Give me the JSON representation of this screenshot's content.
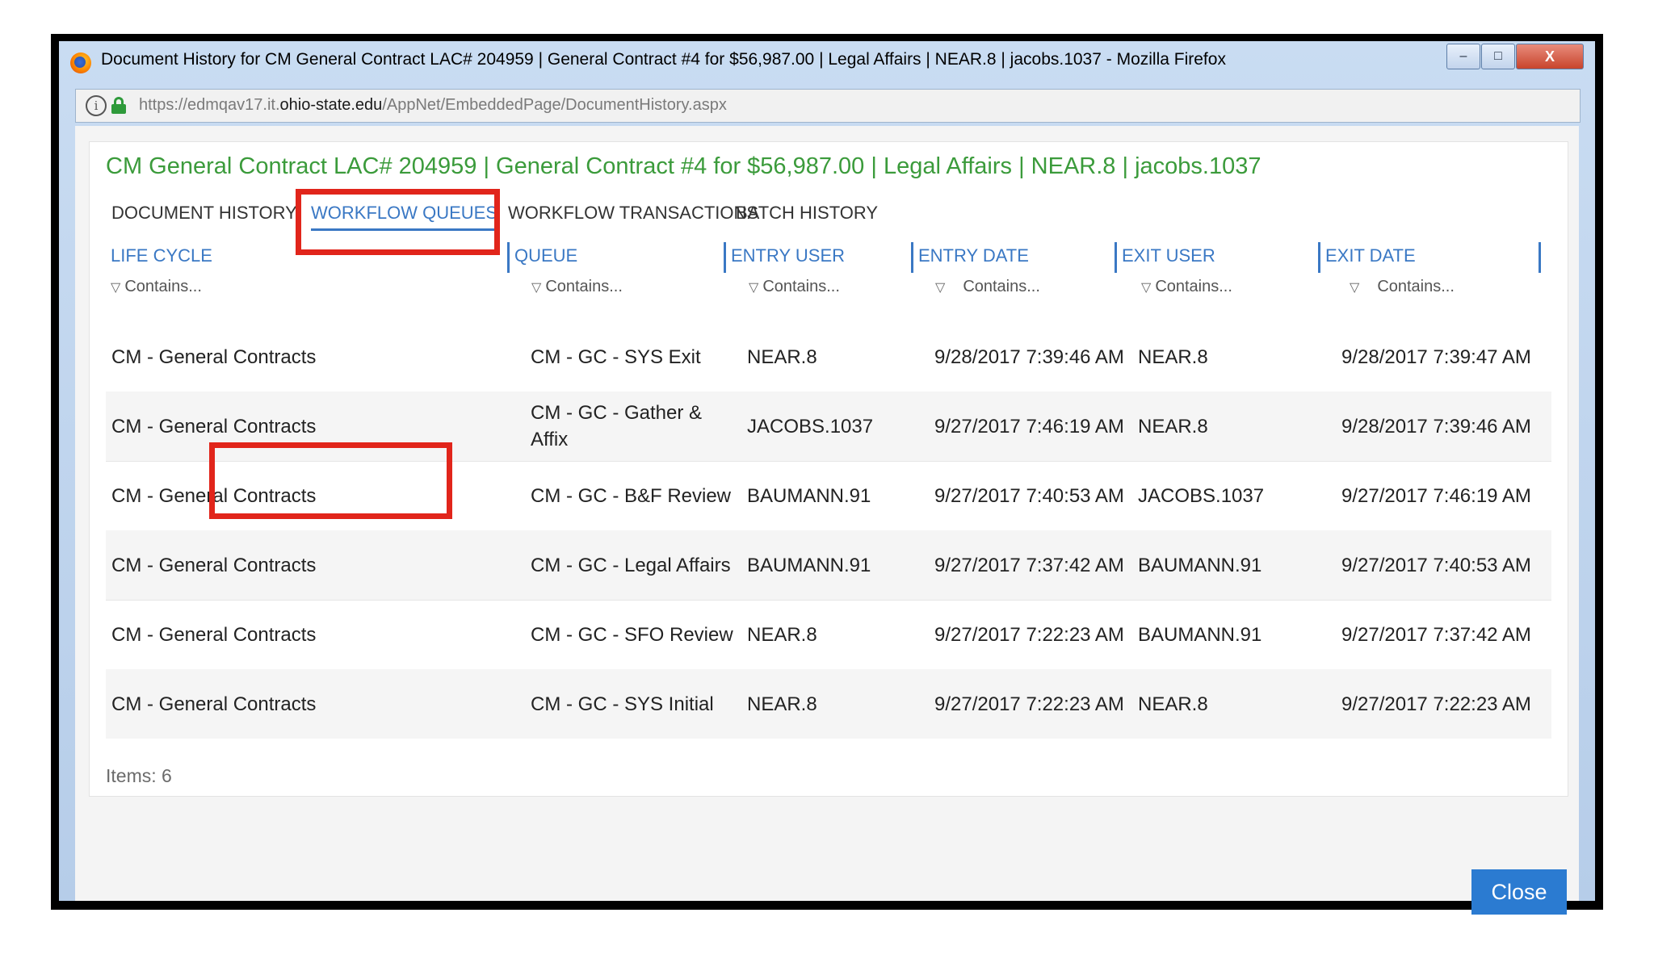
{
  "window": {
    "title": "Document History for CM General Contract LAC# 204959 | General Contract #4 for $56,987.00 | Legal Affairs | NEAR.8 | jacobs.1037 - Mozilla Firefox",
    "controls": {
      "minimize": "–",
      "maximize": "□",
      "close": "X"
    }
  },
  "urlbar": {
    "prefix": "https://edmqav17.it.",
    "domain": "ohio-state.edu",
    "path": "/AppNet/EmbeddedPage/DocumentHistory.aspx"
  },
  "document_title": "CM General Contract LAC# 204959 | General Contract #4 for $56,987.00 | Legal Affairs | NEAR.8 | jacobs.1037",
  "tabs": [
    {
      "label": "DOCUMENT HISTORY",
      "active": false
    },
    {
      "label": "WORKFLOW QUEUES",
      "active": true
    },
    {
      "label": "WORKFLOW TRANSACTIONS",
      "active": false
    },
    {
      "label": "BATCH HISTORY",
      "active": false
    }
  ],
  "grid": {
    "columns": [
      "LIFE CYCLE",
      "QUEUE",
      "ENTRY USER",
      "ENTRY DATE",
      "EXIT USER",
      "EXIT DATE"
    ],
    "filter_placeholder": "Contains...",
    "rows": [
      [
        "CM - General Contracts",
        "CM - GC - SYS Exit",
        "NEAR.8",
        "9/28/2017 7:39:46 AM",
        "NEAR.8",
        "9/28/2017 7:39:47 AM"
      ],
      [
        "CM - General Contracts",
        "CM - GC - Gather & Affix",
        "JACOBS.1037",
        "9/27/2017 7:46:19 AM",
        "NEAR.8",
        "9/28/2017 7:39:46 AM"
      ],
      [
        "CM - General Contracts",
        "CM - GC - B&F Review",
        "BAUMANN.91",
        "9/27/2017 7:40:53 AM",
        "JACOBS.1037",
        "9/27/2017 7:46:19 AM"
      ],
      [
        "CM - General Contracts",
        "CM - GC - Legal Affairs",
        "BAUMANN.91",
        "9/27/2017 7:37:42 AM",
        "BAUMANN.91",
        "9/27/2017 7:40:53 AM"
      ],
      [
        "CM - General Contracts",
        "CM - GC - SFO Review",
        "NEAR.8",
        "9/27/2017 7:22:23 AM",
        "BAUMANN.91",
        "9/27/2017 7:37:42 AM"
      ],
      [
        "CM - General Contracts",
        "CM - GC - SYS Initial",
        "NEAR.8",
        "9/27/2017 7:22:23 AM",
        "NEAR.8",
        "9/27/2017 7:22:23 AM"
      ]
    ]
  },
  "items_label": "Items: 6",
  "close_label": "Close",
  "colors": {
    "accent": "#3a78c4",
    "title_green": "#3b9b3b",
    "highlight_red": "#e1251b",
    "close_button": "#2b7bd1"
  },
  "icons": [
    "firefox-icon",
    "info-icon",
    "lock-icon",
    "filter-icon"
  ]
}
